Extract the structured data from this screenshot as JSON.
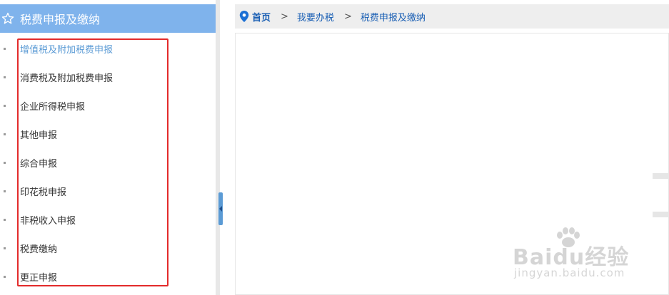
{
  "sidebar": {
    "title": "税费申报及缴纳",
    "items": [
      {
        "label": "增值税及附加税费申报",
        "active": true
      },
      {
        "label": "消费税及附加税费申报"
      },
      {
        "label": "企业所得税申报"
      },
      {
        "label": "其他申报"
      },
      {
        "label": "综合申报"
      },
      {
        "label": "印花税申报"
      },
      {
        "label": "非税收入申报"
      },
      {
        "label": "税费缴纳"
      },
      {
        "label": "更正申报"
      }
    ]
  },
  "breadcrumb": {
    "home": "首页",
    "separator": ">",
    "items": [
      "我要办税",
      "税费申报及缴纳"
    ]
  },
  "watermark": {
    "brand": "Baidu经验",
    "url": "jingyan.baidu.com"
  },
  "colors": {
    "sidebar_header": "#7fb3ec",
    "highlight_box": "#e32b2b",
    "link": "#1a5fb4",
    "active_item": "#5b9bd5"
  }
}
